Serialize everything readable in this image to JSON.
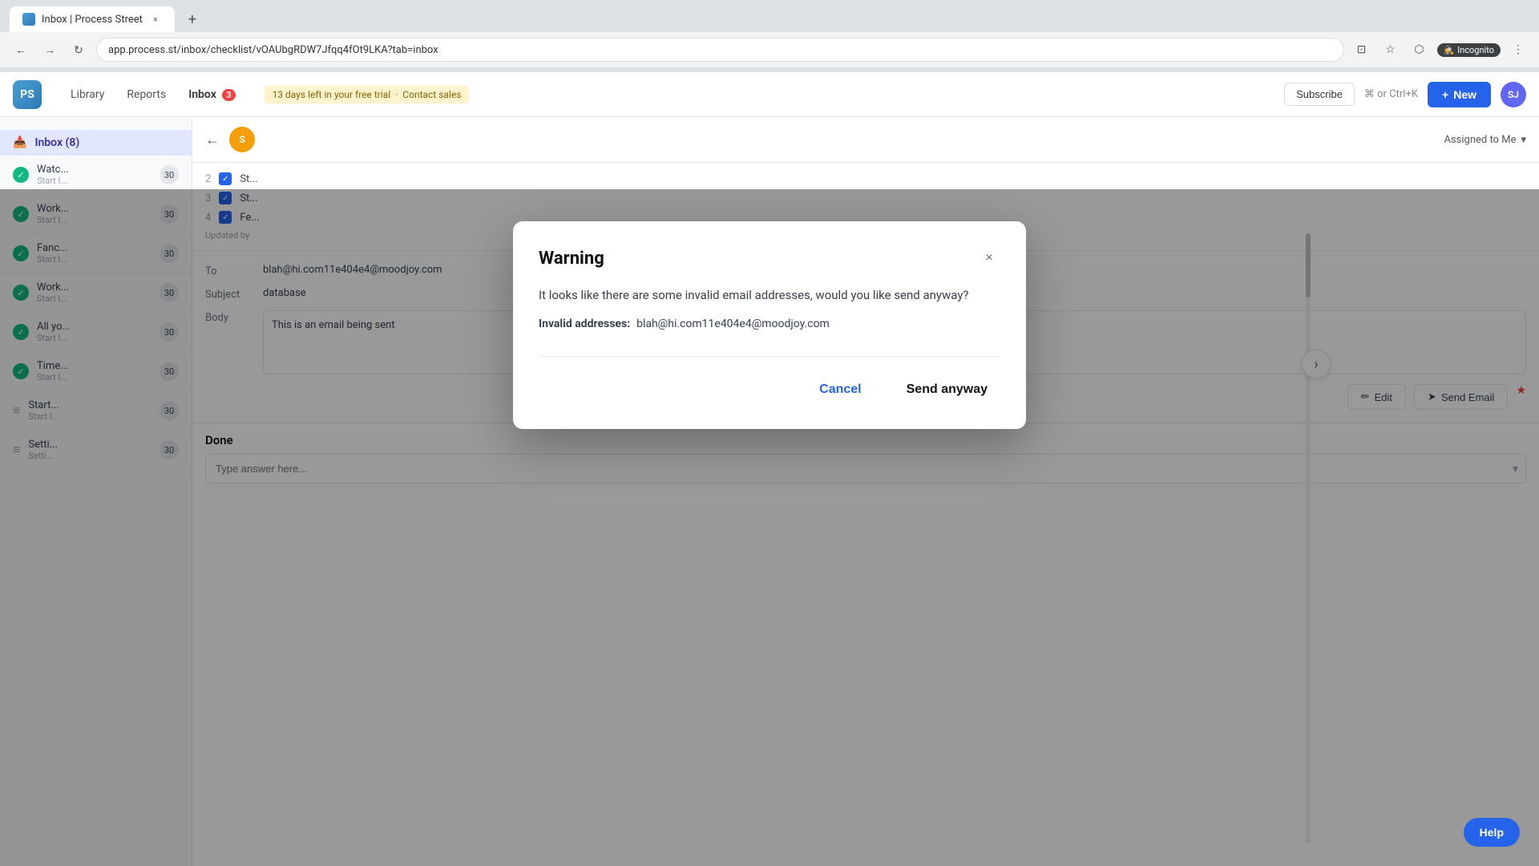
{
  "browser": {
    "tab_title": "Inbox | Process Street",
    "tab_close": "×",
    "new_tab": "+",
    "url": "app.process.st/inbox/checklist/vOAUbgRDW7Jfqq4fOt9LKA?tab=inbox",
    "nav_back": "←",
    "nav_forward": "→",
    "nav_reload": "↻",
    "incognito_label": "Incognito"
  },
  "topbar": {
    "logo": "PS",
    "nav_items": [
      "Library",
      "Reports",
      "Inbox"
    ],
    "inbox_count": "3",
    "trial_text": "13 days left in your free trial",
    "contact_sales": "Contact sales",
    "subscribe_label": "Subscribe",
    "search_shortcut": "⌘ or Ctrl+K",
    "new_label": "New",
    "avatar_initials": "SJ"
  },
  "sidebar": {
    "inbox_label": "Inbox (8)",
    "items": [
      {
        "label": "Watc...",
        "sub": "Start I...",
        "badge": "30",
        "type": "check"
      },
      {
        "label": "Work...",
        "sub": "Start I...",
        "badge": "30",
        "type": "check"
      },
      {
        "label": "Fanc...",
        "sub": "Start I...",
        "badge": "30",
        "type": "check"
      },
      {
        "label": "Work...",
        "sub": "Start I...",
        "badge": "30",
        "type": "check"
      },
      {
        "label": "All yo...",
        "sub": "Start I...",
        "badge": "30",
        "type": "check"
      },
      {
        "label": "Time...",
        "sub": "Start I...",
        "badge": "30",
        "type": "check"
      },
      {
        "label": "Start...",
        "sub": "Start I...",
        "badge": "30",
        "type": "list"
      },
      {
        "label": "Setti...",
        "sub": "Setti...",
        "badge": "30",
        "type": "list"
      }
    ]
  },
  "content": {
    "back_icon": "←",
    "avatar_text": "S",
    "close_icon": "×",
    "assigned_filter": "Assigned to Me",
    "steps": [
      {
        "num": "2",
        "label": "St...",
        "checked": true
      },
      {
        "num": "3",
        "label": "St...",
        "checked": true
      },
      {
        "num": "4",
        "label": "Fe...",
        "checked": true
      }
    ],
    "updated_by": "Updated by",
    "close_panel_icon": "×",
    "nav_arrow": "›",
    "email_to_label": "To",
    "email_to_value": "blah@hi.com11e404e4@moodjoy.com",
    "email_subject_label": "Subject",
    "email_subject_value": "database",
    "email_body_label": "Body",
    "email_body_value": "This is an email being sent",
    "edit_label": "Edit",
    "send_email_label": "Send Email",
    "required_star": "★",
    "done_label": "Done",
    "done_placeholder": "Type answer here..."
  },
  "modal": {
    "title": "Warning",
    "close_icon": "×",
    "body_text": "It looks like there are some invalid email addresses, would you like send anyway?",
    "invalid_label": "Invalid addresses:",
    "invalid_email": "blah@hi.com11e404e4@moodjoy.com",
    "cancel_label": "Cancel",
    "send_anyway_label": "Send anyway"
  },
  "help": {
    "label": "Help"
  },
  "colors": {
    "accent_blue": "#2563eb",
    "danger_red": "#ef4444",
    "success_green": "#10b981"
  }
}
